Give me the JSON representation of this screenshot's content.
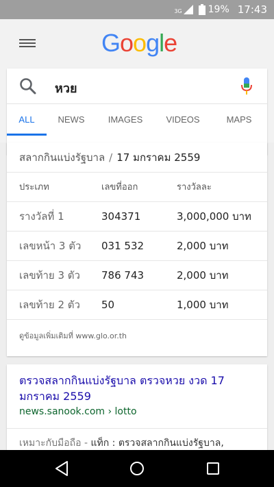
{
  "status_bar": {
    "network": "3G",
    "battery": "19%",
    "time": "17:43"
  },
  "header": {
    "logo": [
      "G",
      "o",
      "o",
      "g",
      "l",
      "e"
    ]
  },
  "search": {
    "query": "หวย",
    "tabs": [
      {
        "label": "ALL",
        "active": true
      },
      {
        "label": "NEWS",
        "active": false
      },
      {
        "label": "IMAGES",
        "active": false
      },
      {
        "label": "VIDEOS",
        "active": false
      },
      {
        "label": "MAPS",
        "active": false
      }
    ]
  },
  "lottery": {
    "source": "สลากกินแบ่งรัฐบาล",
    "separator": "/",
    "date": "17 มกราคม 2559",
    "columns": [
      "ประเภท",
      "เลขที่ออก",
      "รางวัลละ"
    ],
    "rows": [
      [
        "รางวัลที่ 1",
        "304371",
        "3,000,000 บาท"
      ],
      [
        "เลขหน้า 3 ตัว",
        "031 532",
        "2,000 บาท"
      ],
      [
        "เลขท้าย 3 ตัว",
        "786 743",
        "2,000 บาท"
      ],
      [
        "เลขท้าย 2 ตัว",
        "50",
        "1,000 บาท"
      ]
    ],
    "more_info": "ดูข้อมูลเพิ่มเติมที่ www.glo.or.th"
  },
  "result": {
    "title": "ตรวจสลากกินแบ่งรัฐบาล ตรวจหวย งวด 17 มกราคม 2559",
    "url": "news.sanook.com › lotto",
    "snippet_prefix": "เหมาะกับมือถือ",
    "snippet_dash": " - ",
    "snippet_text": "แท็ก : ตรวจสลากกินแบ่งรัฐบาล,"
  },
  "colors": {
    "accent": "#1a73e8",
    "link": "#1a0dab",
    "url": "#0d652d"
  }
}
